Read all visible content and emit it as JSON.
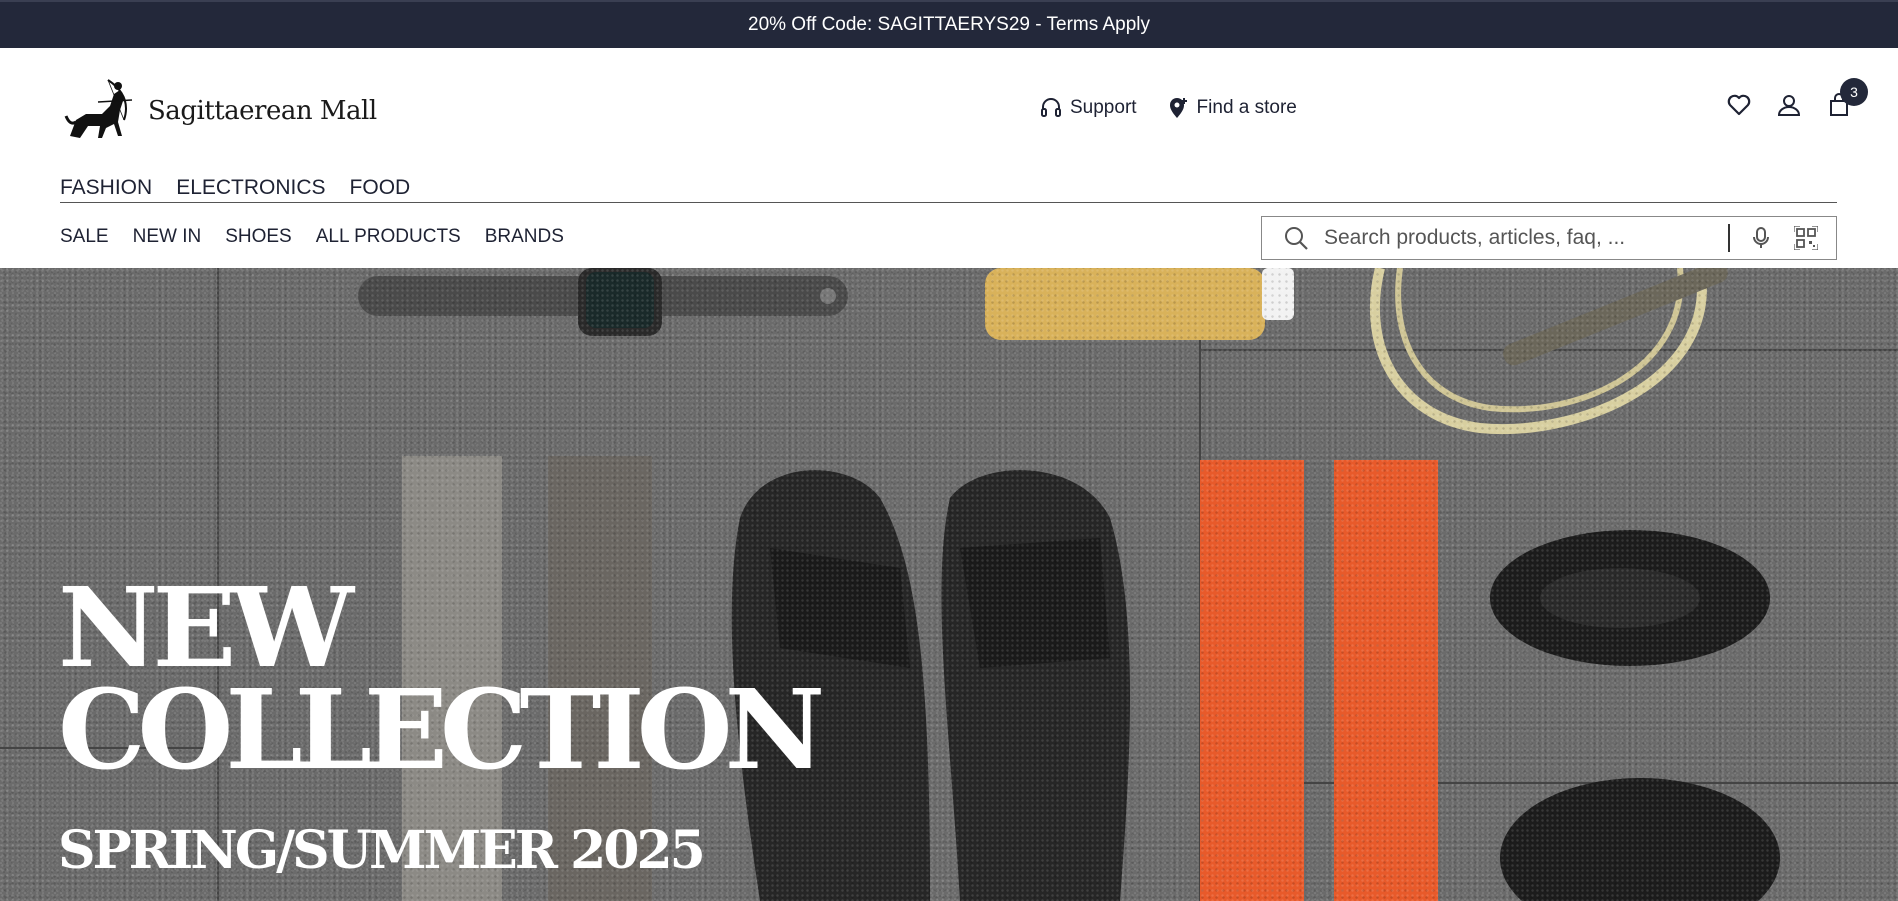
{
  "promo": {
    "text": "20% Off Code: SAGITTAERYS29 - Terms Apply"
  },
  "brand": {
    "name": "Sagittaerean Mall"
  },
  "utility": {
    "support": "Support",
    "find_store": "Find a store"
  },
  "cart": {
    "count": "3"
  },
  "categories": [
    "FASHION",
    "ELECTRONICS",
    "FOOD"
  ],
  "subnav": [
    "SALE",
    "NEW IN",
    "SHOES",
    "ALL PRODUCTS",
    "BRANDS"
  ],
  "search": {
    "placeholder": "Search products, articles, faq, ..."
  },
  "hero": {
    "line1": "NEW",
    "line2": "COLLECTION",
    "subtitle": "SPRING/SUMMER 2025"
  },
  "colors": {
    "dark": "#23283a",
    "accent_orange": "#e85a2a",
    "white": "#ffffff"
  }
}
